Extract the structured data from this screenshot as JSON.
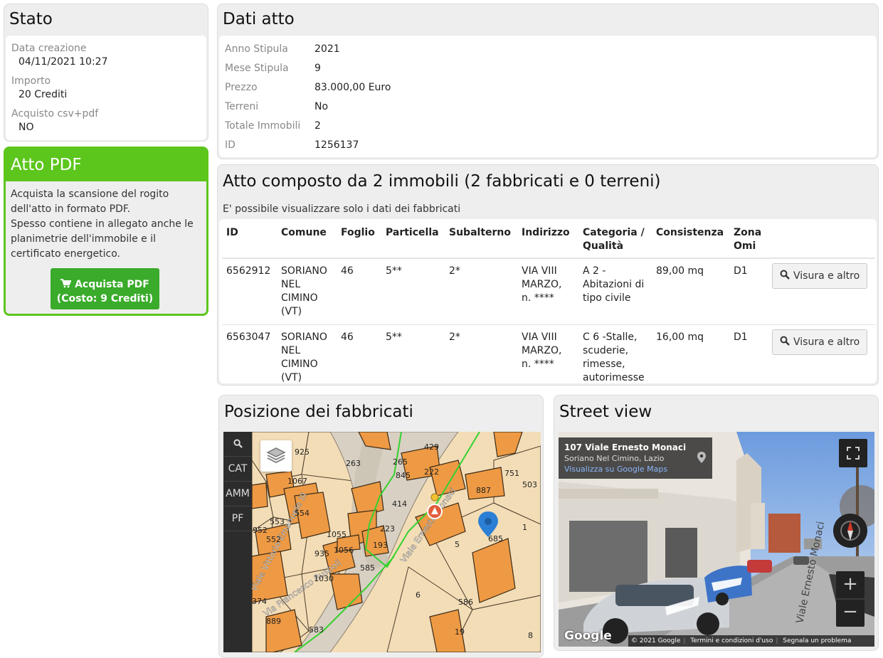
{
  "stato": {
    "title": "Stato",
    "fields": [
      {
        "label": "Data creazione",
        "value": "04/11/2021 10:27"
      },
      {
        "label": "Importo",
        "value": "20 Crediti"
      },
      {
        "label": "Acquisto csv+pdf",
        "value": "NO"
      }
    ]
  },
  "atto_pdf": {
    "title": "Atto PDF",
    "description_1": "Acquista la scansione del rogito dell'atto in formato PDF.",
    "description_2": "Spesso contiene in allegato anche le planimetrie dell'immobile e il certificato energetico.",
    "button_line1": "Acquista PDF",
    "button_line2": "(Costo: 9 Crediti)",
    "button_icon": "cart-icon",
    "accent": "#5cc61c"
  },
  "dati_atto": {
    "title": "Dati atto",
    "fields": [
      {
        "label": "Anno Stipula",
        "value": "2021"
      },
      {
        "label": "Mese Stipula",
        "value": "9"
      },
      {
        "label": "Prezzo",
        "value": "83.000,00 Euro"
      },
      {
        "label": "Terreni",
        "value": "No"
      },
      {
        "label": "Totale Immobili",
        "value": "2"
      },
      {
        "label": "ID",
        "value": "1256137"
      }
    ]
  },
  "immobili": {
    "title": "Atto composto da 2 immobili (2 fabbricati e 0 terreni)",
    "note": "E' possibile visualizzare solo i dati dei fabbricati",
    "columns": [
      "ID",
      "Comune",
      "Foglio",
      "Particella",
      "Subalterno",
      "Indirizzo",
      "Categoria / Qualità",
      "Consistenza",
      "Zona Omi"
    ],
    "rows": [
      {
        "id": "6562912",
        "comune": "SORIANO NEL CIMINO (VT)",
        "foglio": "46",
        "particella": "5**",
        "subalterno": "2*",
        "indirizzo": "VIA VIII MARZO, n. ****",
        "categoria": "A 2 - Abitazioni di tipo civile",
        "consistenza": "89,00 mq",
        "zona": "D1",
        "button": "Visura e altro"
      },
      {
        "id": "6563047",
        "comune": "SORIANO NEL CIMINO (VT)",
        "foglio": "46",
        "particella": "5**",
        "subalterno": "2*",
        "indirizzo": "VIA VIII MARZO, n. ****",
        "categoria": "C 6 -Stalle, scuderie, rimesse, autorimesse",
        "consistenza": "16,00 mq",
        "zona": "D1",
        "button": "Visura e altro"
      }
    ]
  },
  "posizione": {
    "title": "Posizione dei fabbricati",
    "tools": [
      "CAT",
      "AMM",
      "PF"
    ],
    "map_labels": [
      "925",
      "263",
      "429",
      "222",
      "845",
      "751",
      "1067",
      "503",
      "414",
      "554",
      "223",
      "553",
      "552",
      "952",
      "193",
      "1055",
      "1056",
      "935",
      "585",
      "1030",
      "6",
      "586",
      "889",
      "583",
      "19",
      "8",
      "685",
      "5",
      "1",
      "265",
      "887",
      "374"
    ],
    "street_labels": [
      "Viale Vittorio Emanuele III",
      "Viale Ernesto Monaci",
      "Via Francesco Ruspoli"
    ]
  },
  "street_view": {
    "title": "Street view",
    "address": "107 Viale Ernesto Monaci",
    "locality": "Soriano Nel Cimino, Lazio",
    "link": "Visualizza su Google Maps",
    "google": "Google",
    "copyright": "© 2021 Google",
    "terms": "Termini e condizioni d'uso",
    "report": "Segnala un problema",
    "street_sign": "Viale Ernesto Monaci"
  }
}
